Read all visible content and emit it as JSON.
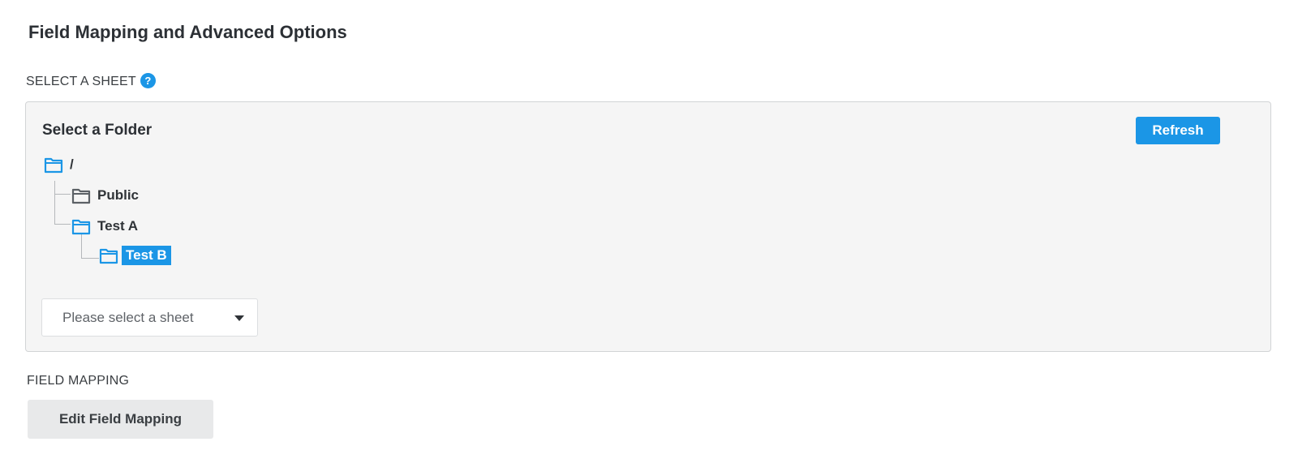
{
  "page": {
    "title": "Field Mapping and Advanced Options"
  },
  "select_sheet": {
    "label": "SELECT A SHEET",
    "help_icon": "?",
    "folder_title": "Select a Folder",
    "refresh_label": "Refresh",
    "tree": {
      "root": "/",
      "public": "Public",
      "test_a": "Test A",
      "test_b": "Test B"
    },
    "sheet_placeholder": "Please select a sheet"
  },
  "field_mapping": {
    "label": "FIELD MAPPING",
    "edit_label": "Edit Field Mapping"
  },
  "colors": {
    "accent": "#1b96e6",
    "folder_gray": "#5c6166"
  },
  "icons": {
    "folder_open": "folder-open-icon",
    "folder": "folder-icon",
    "help": "help-icon",
    "dropdown": "caret-down-icon"
  }
}
